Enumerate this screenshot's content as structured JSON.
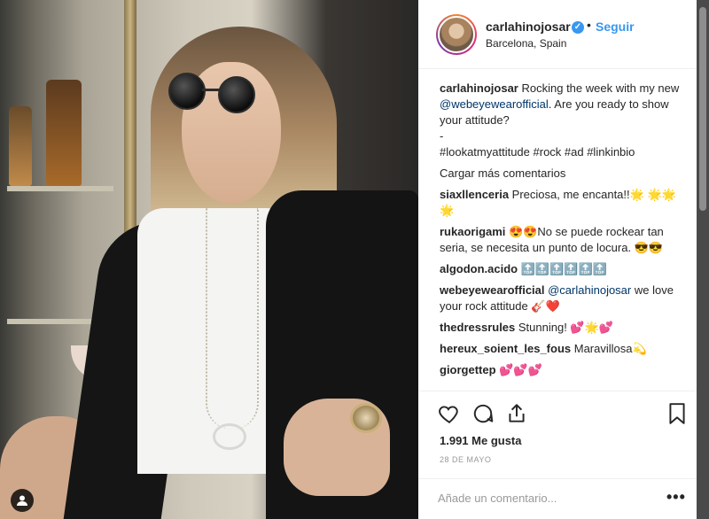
{
  "post": {
    "username": "carlahinojosar",
    "follow_label": "Seguir",
    "separator": "•",
    "location": "Barcelona, Spain",
    "caption": {
      "user": "carlahinojosar",
      "text_1": " Rocking the week with my new ",
      "mention": "@webeyewearofficial",
      "text_2": ". Are you ready to show your attitude?",
      "dash": "-",
      "hashtags": "#lookatmyattitude #rock #ad #linkinbio"
    },
    "load_more": "Cargar más comentarios",
    "comments": [
      {
        "user": "siaxllenceria",
        "text": " Preciosa, me encanta!!",
        "emoji": "🌟 🌟🌟🌟"
      },
      {
        "user": "rukaorigami",
        "emoji_pre": " 😍😍",
        "text": "No se puede rockear tan seria, se necesita un punto de locura.",
        "emoji": "😎😎"
      },
      {
        "user": "algodon.acido",
        "emoji": "🔝🔝🔝🔝🔝🔝"
      },
      {
        "user": "webeyewearofficial",
        "mention": " @carlahinojosar",
        "text": " we love your rock attitude ",
        "emoji": "🎸❤️"
      },
      {
        "user": "thedressrules",
        "text": " Stunning! ",
        "emoji": "💕🌟💕"
      },
      {
        "user": "hereux_soient_les_fous",
        "text": " Maravillosa",
        "emoji": "💫"
      },
      {
        "user": "giorgettep",
        "emoji": " 💕💕💕"
      }
    ],
    "likes": "1.991 Me gusta",
    "date": "28 DE MAYO",
    "add_comment_placeholder": "Añade un comentario...",
    "more_label": "•••"
  },
  "icons": [
    "heart-icon",
    "comment-icon",
    "share-icon",
    "bookmark-icon",
    "verified-icon",
    "user-tag-icon"
  ],
  "colors": {
    "accent": "#3897f0",
    "text": "#262626",
    "muted": "#999999",
    "link": "#003569"
  }
}
